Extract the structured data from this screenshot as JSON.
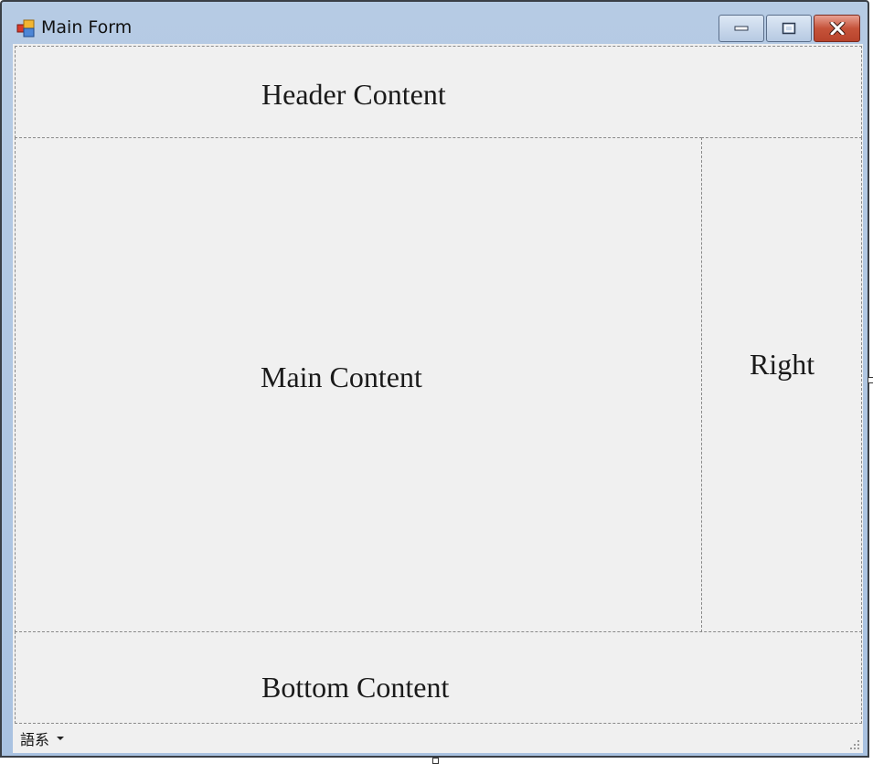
{
  "window": {
    "title": "Main Form",
    "icon": "app-window-icon",
    "controls": [
      "minimize-icon",
      "maximize-icon",
      "close-icon"
    ]
  },
  "panels": {
    "header": "Header Content",
    "main": "Main Content",
    "right": "Right",
    "bottom": "Bottom Content"
  },
  "statusbar": {
    "language_label": "語系"
  },
  "colors": {
    "client_bg": "#f0f0f0",
    "titlebar": "#a9c2e1",
    "close_button": "#c5533a"
  }
}
